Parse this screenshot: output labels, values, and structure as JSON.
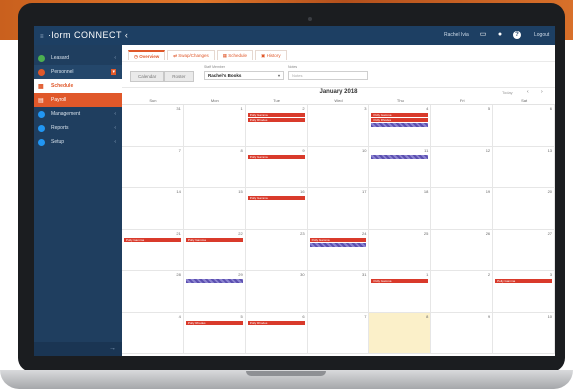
{
  "app": {
    "logo_mark": "≡",
    "logo_text": "·lorm CONNECT ‹",
    "user_name": "Rachel Ivia",
    "logout": "Logout"
  },
  "sidebar": {
    "items": [
      {
        "label": "Leasard",
        "color": "#4caf50"
      },
      {
        "label": "Personnel",
        "color": "#e0582a"
      },
      {
        "label": "Schedule",
        "color": "#e0582a"
      },
      {
        "label": "Payroll",
        "color": "#e0582a"
      },
      {
        "label": "Management",
        "color": "#2196f3"
      },
      {
        "label": "Reports",
        "color": "#2196f3"
      },
      {
        "label": "Setup",
        "color": "#2196f3"
      }
    ],
    "collapse_icon": "→"
  },
  "tabs": [
    {
      "label": "Overview"
    },
    {
      "label": "Swap/Changes"
    },
    {
      "label": "Schedule"
    },
    {
      "label": "History"
    }
  ],
  "filters": {
    "view_options": [
      "Calendar",
      "Roster"
    ],
    "staff_label": "Staff Member",
    "staff_value": "Rachel's Books",
    "notes_label": "Notes",
    "notes_placeholder": "Notes"
  },
  "calendar": {
    "month_title": "January 2018",
    "today_label": "Today",
    "prev": "‹",
    "next": "›",
    "weekdays": [
      "Sun",
      "Mon",
      "Tue",
      "Wed",
      "Thu",
      "Fri",
      "Sat"
    ],
    "weeks": [
      [
        "31",
        "1",
        "2",
        "3",
        "4",
        "5",
        "6"
      ],
      [
        "7",
        "8",
        "9",
        "10",
        "11",
        "12",
        "13"
      ],
      [
        "14",
        "15",
        "16",
        "17",
        "18",
        "19",
        "20"
      ],
      [
        "21",
        "22",
        "23",
        "24",
        "25",
        "26",
        "27"
      ],
      [
        "28",
        "29",
        "30",
        "31",
        "1",
        "2",
        "3"
      ],
      [
        "4",
        "5",
        "6",
        "7",
        "8",
        "9",
        "10"
      ]
    ],
    "event_label": "Polly Gamma",
    "event_label_alt": "Polly Rhodes"
  },
  "colors": {
    "accent": "#e0582a",
    "navy": "#1f3e5f",
    "event_red": "#d93a2b",
    "event_purple": "#5b4fb0"
  }
}
